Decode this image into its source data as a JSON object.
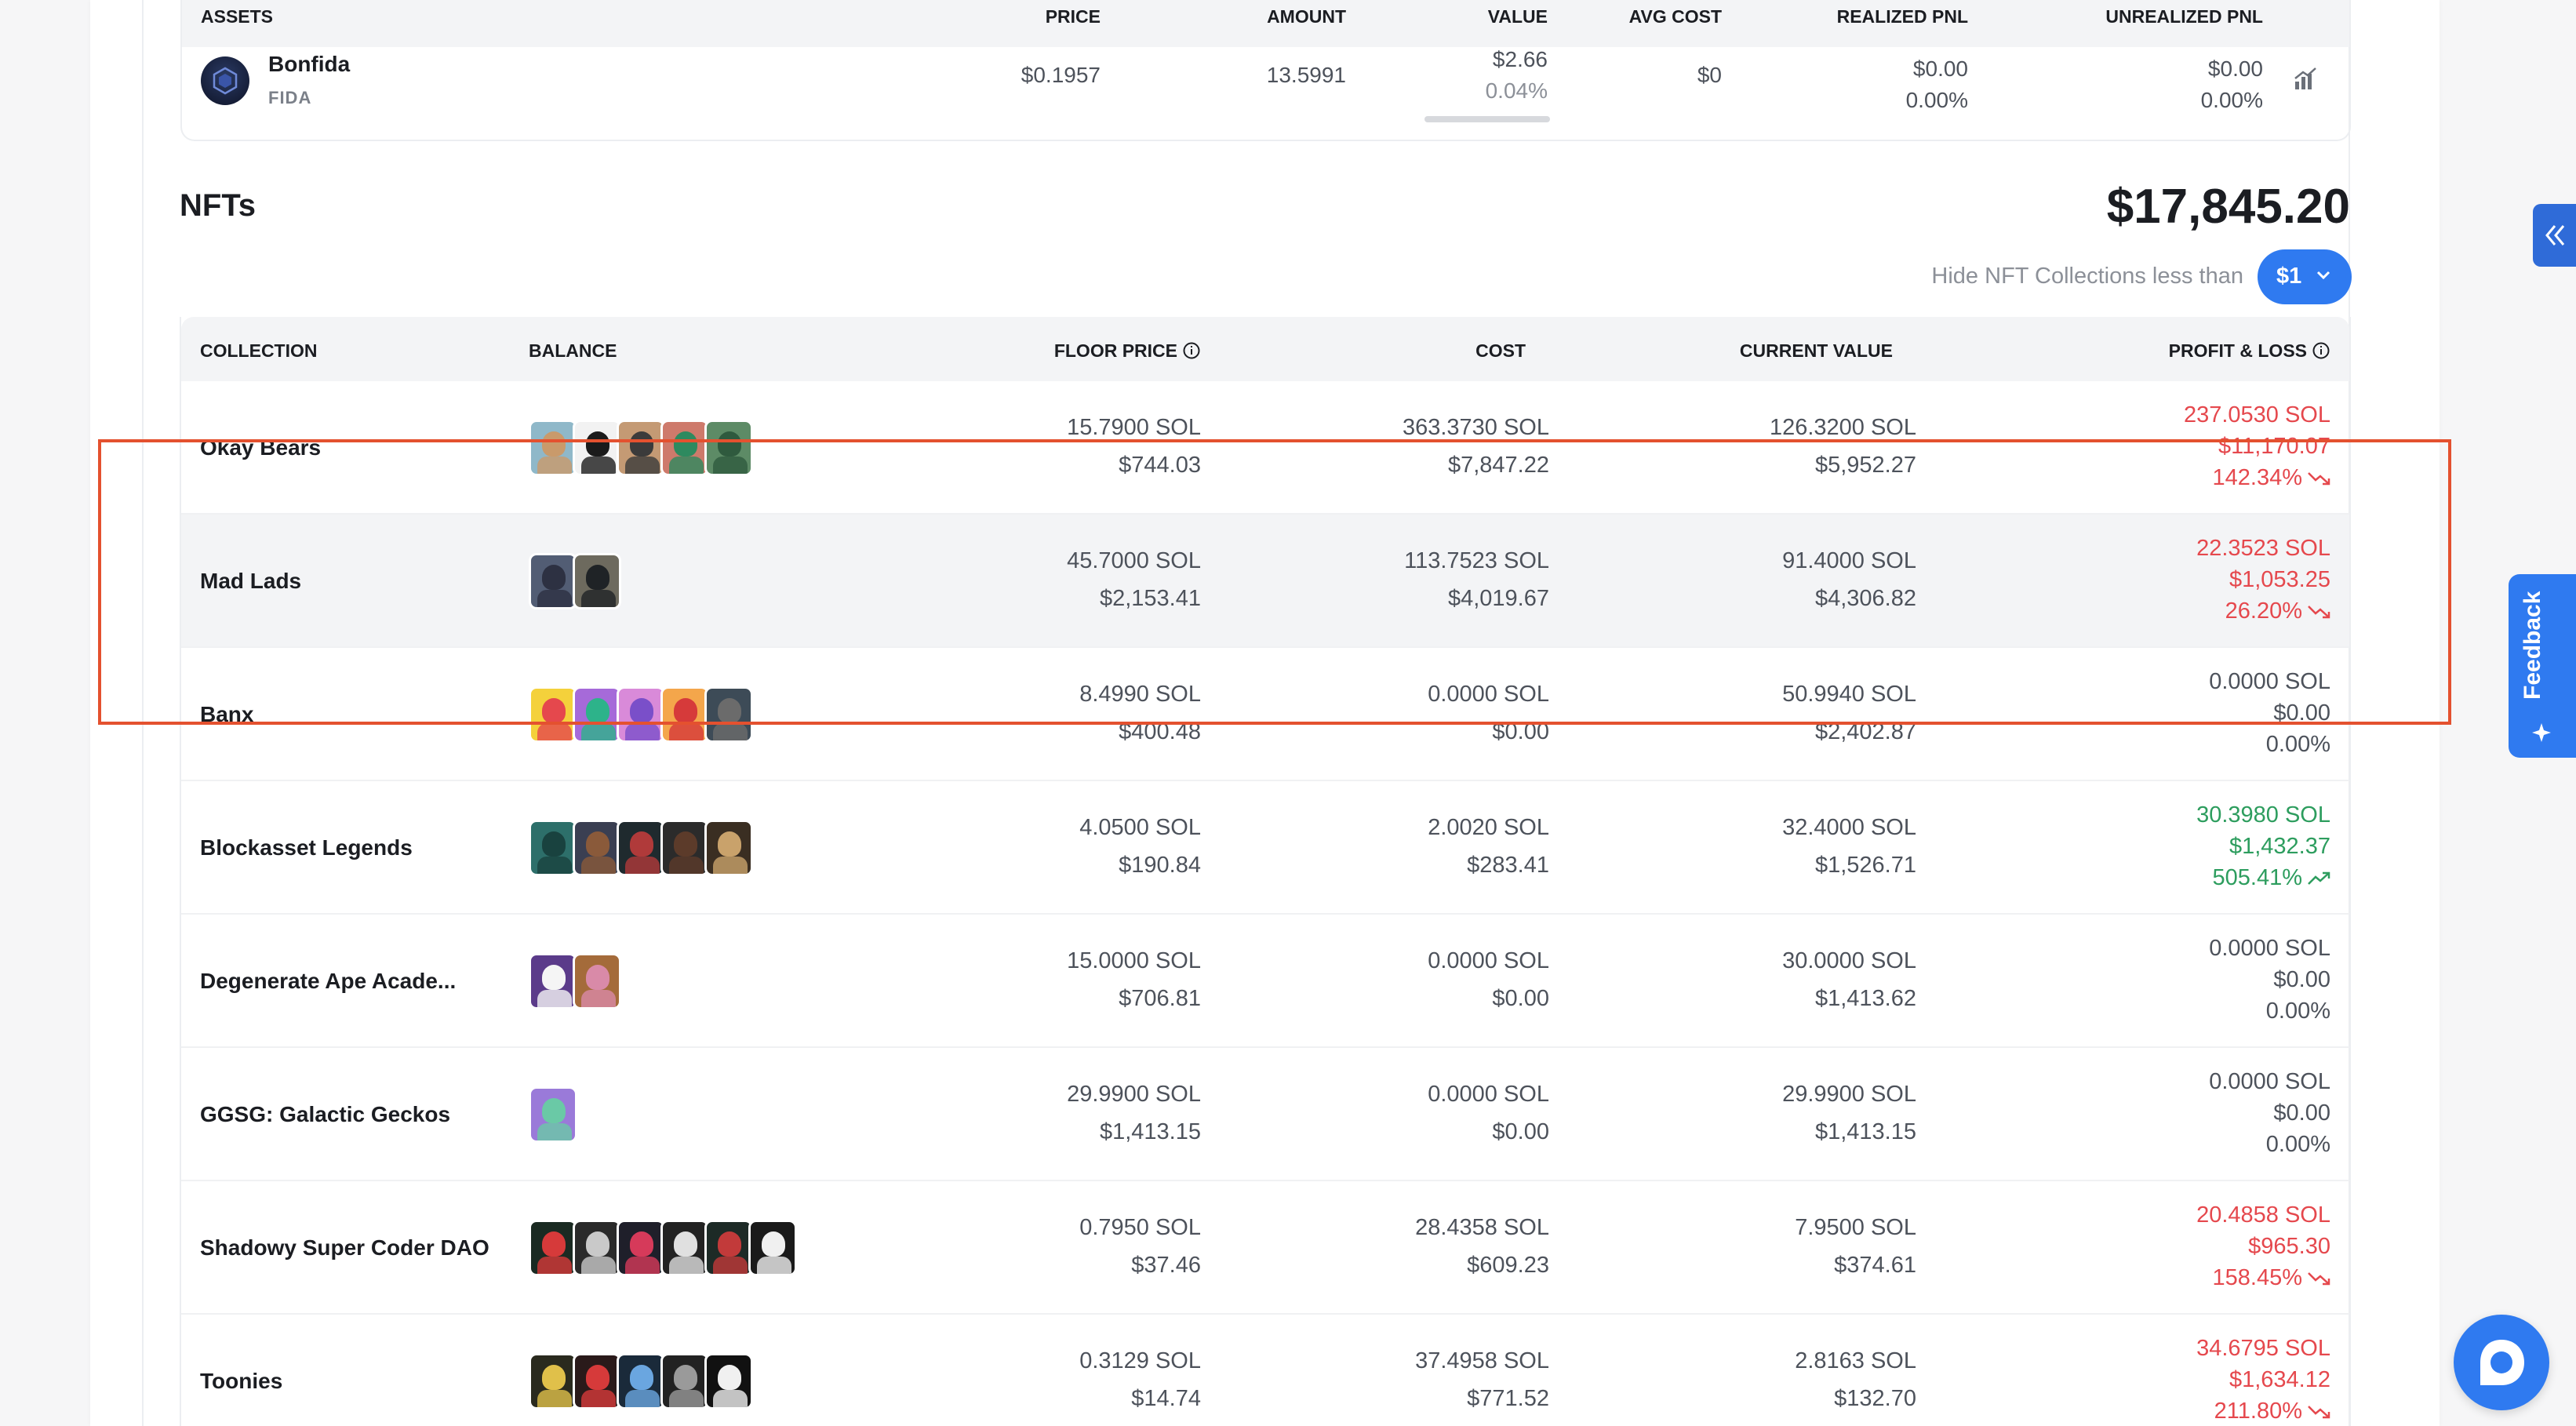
{
  "assets": {
    "headers": {
      "assets": "ASSETS",
      "price": "PRICE",
      "amount": "AMOUNT",
      "value": "VALUE",
      "avg_cost": "AVG COST",
      "realized_pnl": "REALIZED PNL",
      "unrealized_pnl": "UNREALIZED PNL"
    },
    "row": {
      "name": "Bonfida",
      "symbol": "FIDA",
      "price": "$0.1957",
      "amount": "13.5991",
      "value": "$2.66",
      "value_pct": "0.04%",
      "avg_cost": "$0",
      "realized_usd": "$0.00",
      "realized_pct": "0.00%",
      "unrealized_usd": "$0.00",
      "unrealized_pct": "0.00%",
      "value_share": 0.04
    }
  },
  "nfts": {
    "title": "NFTs",
    "total": "$17,845.20",
    "hide_label": "Hide NFT Collections less than",
    "threshold": "$1",
    "headers": {
      "collection": "COLLECTION",
      "balance": "BALANCE",
      "floor_price": "FLOOR PRICE",
      "cost": "COST",
      "current_value": "CURRENT VALUE",
      "profit_loss": "PROFIT & LOSS"
    },
    "rows": [
      {
        "name": "Okay Bears",
        "floor_sol": "15.7900 SOL",
        "floor_usd": "$744.03",
        "cost_sol": "363.3730 SOL",
        "cost_usd": "$7,847.22",
        "value_sol": "126.3200 SOL",
        "value_usd": "$5,952.27",
        "pl_sol": "237.0530 SOL",
        "pl_usd": "$11,170.07",
        "pl_pct": "142.34%",
        "trend": "down"
      },
      {
        "name": "Mad Lads",
        "floor_sol": "45.7000 SOL",
        "floor_usd": "$2,153.41",
        "cost_sol": "113.7523 SOL",
        "cost_usd": "$4,019.67",
        "value_sol": "91.4000 SOL",
        "value_usd": "$4,306.82",
        "pl_sol": "22.3523 SOL",
        "pl_usd": "$1,053.25",
        "pl_pct": "26.20%",
        "trend": "down"
      },
      {
        "name": "Banx",
        "floor_sol": "8.4990 SOL",
        "floor_usd": "$400.48",
        "cost_sol": "0.0000 SOL",
        "cost_usd": "$0.00",
        "value_sol": "50.9940 SOL",
        "value_usd": "$2,402.87",
        "pl_sol": "0.0000 SOL",
        "pl_usd": "$0.00",
        "pl_pct": "0.00%",
        "trend": "flat"
      },
      {
        "name": "Blockasset Legends",
        "floor_sol": "4.0500 SOL",
        "floor_usd": "$190.84",
        "cost_sol": "2.0020 SOL",
        "cost_usd": "$283.41",
        "value_sol": "32.4000 SOL",
        "value_usd": "$1,526.71",
        "pl_sol": "30.3980 SOL",
        "pl_usd": "$1,432.37",
        "pl_pct": "505.41%",
        "trend": "up"
      },
      {
        "name": "Degenerate Ape Acade...",
        "floor_sol": "15.0000 SOL",
        "floor_usd": "$706.81",
        "cost_sol": "0.0000 SOL",
        "cost_usd": "$0.00",
        "value_sol": "30.0000 SOL",
        "value_usd": "$1,413.62",
        "pl_sol": "0.0000 SOL",
        "pl_usd": "$0.00",
        "pl_pct": "0.00%",
        "trend": "flat"
      },
      {
        "name": "GGSG: Galactic Geckos",
        "floor_sol": "29.9900 SOL",
        "floor_usd": "$1,413.15",
        "cost_sol": "0.0000 SOL",
        "cost_usd": "$0.00",
        "value_sol": "29.9900 SOL",
        "value_usd": "$1,413.15",
        "pl_sol": "0.0000 SOL",
        "pl_usd": "$0.00",
        "pl_pct": "0.00%",
        "trend": "flat"
      },
      {
        "name": "Shadowy Super Coder DAO",
        "floor_sol": "0.7950 SOL",
        "floor_usd": "$37.46",
        "cost_sol": "28.4358 SOL",
        "cost_usd": "$609.23",
        "value_sol": "7.9500 SOL",
        "value_usd": "$374.61",
        "pl_sol": "20.4858 SOL",
        "pl_usd": "$965.30",
        "pl_pct": "158.45%",
        "trend": "down"
      },
      {
        "name": "Toonies",
        "floor_sol": "0.3129 SOL",
        "floor_usd": "$14.74",
        "cost_sol": "37.4958 SOL",
        "cost_usd": "$771.52",
        "value_sol": "2.8163 SOL",
        "value_usd": "$132.70",
        "pl_sol": "34.6795 SOL",
        "pl_usd": "$1,634.12",
        "pl_pct": "211.80%",
        "trend": "down"
      }
    ]
  },
  "widgets": {
    "feedback_label": "Feedback"
  },
  "colors": {
    "accent": "#2f7af0",
    "loss": "#e5484d",
    "gain": "#2d9d5e",
    "highlight_box": "#e4512f"
  }
}
